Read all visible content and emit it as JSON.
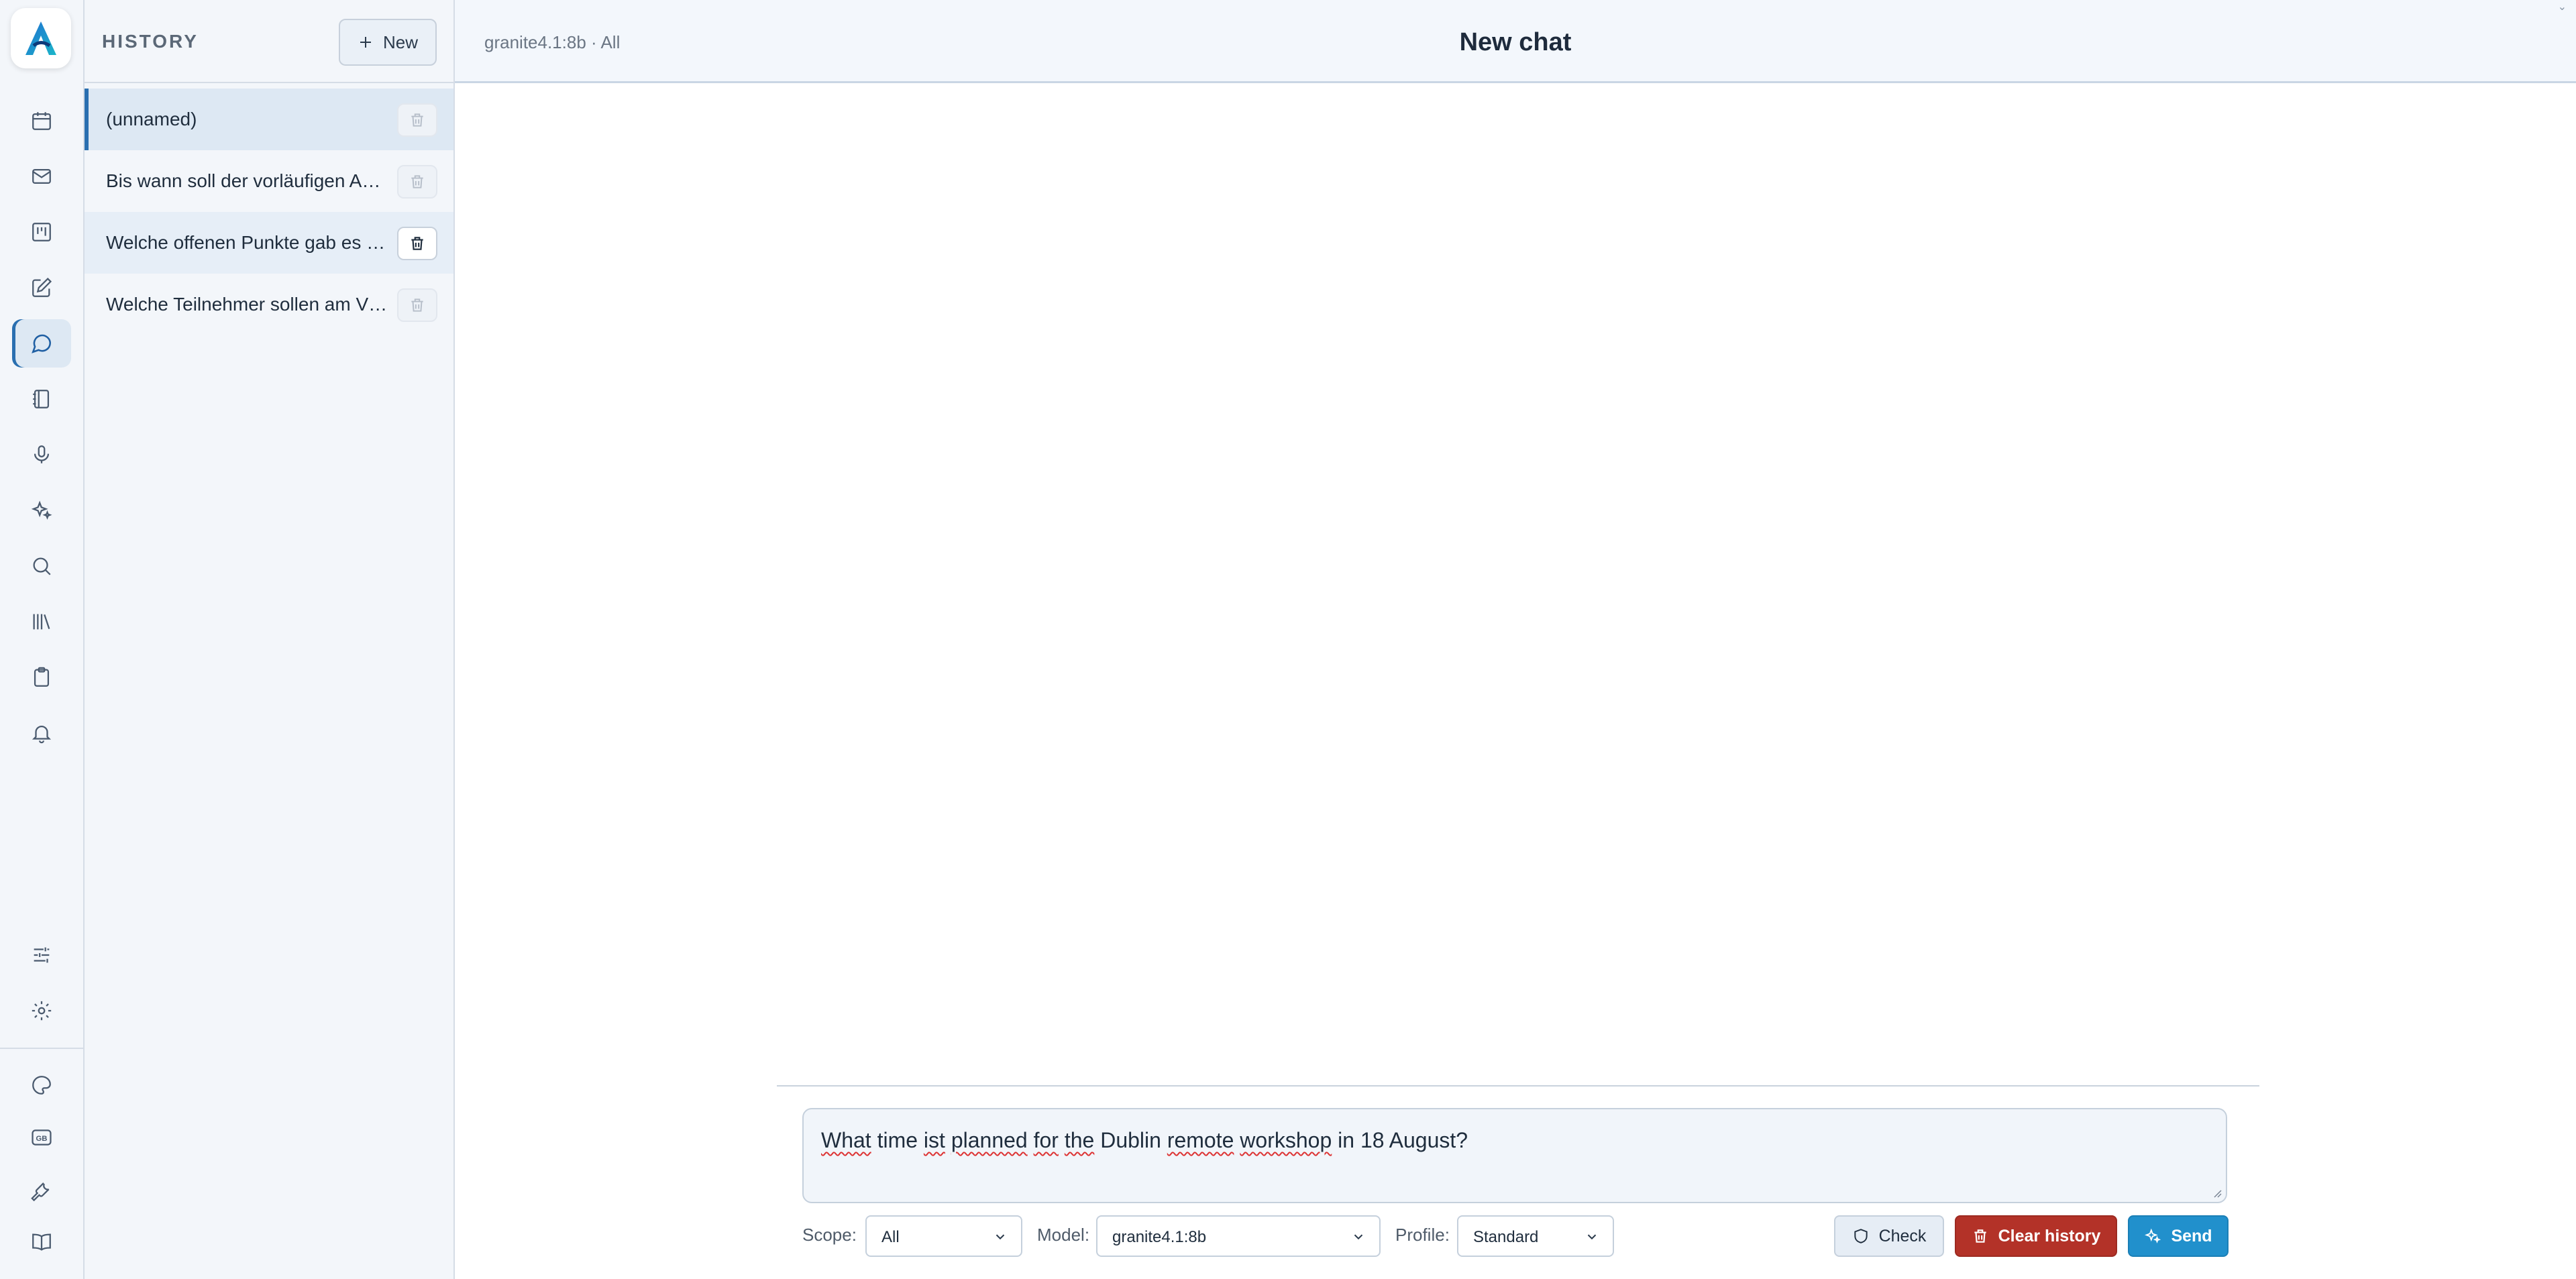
{
  "nav": {
    "items": [
      {
        "icon": "calendar-icon",
        "active": false
      },
      {
        "icon": "mail-icon",
        "active": false
      },
      {
        "icon": "kanban-icon",
        "active": false
      },
      {
        "icon": "edit-icon",
        "active": false
      },
      {
        "icon": "chat-bubble-icon",
        "active": true
      },
      {
        "icon": "notebook-icon",
        "active": false
      },
      {
        "icon": "microphone-icon",
        "active": false
      },
      {
        "icon": "sparkles-icon",
        "active": false
      },
      {
        "icon": "search-icon",
        "active": false
      },
      {
        "icon": "library-icon",
        "active": false
      },
      {
        "icon": "clipboard-icon",
        "active": false
      },
      {
        "icon": "bell-icon",
        "active": false
      }
    ],
    "bottom_items": [
      {
        "icon": "sliders-icon"
      },
      {
        "icon": "gear-icon"
      },
      {
        "icon": "palette-icon"
      },
      {
        "icon": "language-gb-icon",
        "text": "GB"
      },
      {
        "icon": "wrench-icon"
      },
      {
        "icon": "book-icon"
      }
    ]
  },
  "history": {
    "title": "HISTORY",
    "new_label": "New",
    "items": [
      {
        "label": "(unnamed)",
        "state": "selected"
      },
      {
        "label": "Bis wann soll der vorläufigen Ab…",
        "state": "normal"
      },
      {
        "label": "Welche offenen Punkte gab es i…",
        "state": "hover"
      },
      {
        "label": "Welche Teilnehmer sollen am V…",
        "state": "normal"
      }
    ]
  },
  "header": {
    "model_info": "granite4.1:8b · All",
    "title": "New chat"
  },
  "composer": {
    "segments": [
      {
        "text": "What",
        "misspelled": true
      },
      {
        "text": " time ",
        "misspelled": false
      },
      {
        "text": "ist",
        "misspelled": true
      },
      {
        "text": " ",
        "misspelled": false
      },
      {
        "text": "planned",
        "misspelled": true
      },
      {
        "text": " ",
        "misspelled": false
      },
      {
        "text": "for",
        "misspelled": true
      },
      {
        "text": " ",
        "misspelled": false
      },
      {
        "text": "the",
        "misspelled": true
      },
      {
        "text": " Dublin ",
        "misspelled": false
      },
      {
        "text": "remote",
        "misspelled": true
      },
      {
        "text": " ",
        "misspelled": false
      },
      {
        "text": "workshop",
        "misspelled": true
      },
      {
        "text": " in 18 August?",
        "misspelled": false
      }
    ]
  },
  "controls": {
    "scope_label": "Scope:",
    "scope_value": "All",
    "model_label": "Model:",
    "model_value": "granite4.1:8b",
    "profile_label": "Profile:",
    "profile_value": "Standard",
    "check_label": "Check",
    "clear_label": "Clear history",
    "send_label": "Send"
  },
  "colors": {
    "accent": "#2a6fb0",
    "send": "#2190cc",
    "danger": "#b33228"
  }
}
